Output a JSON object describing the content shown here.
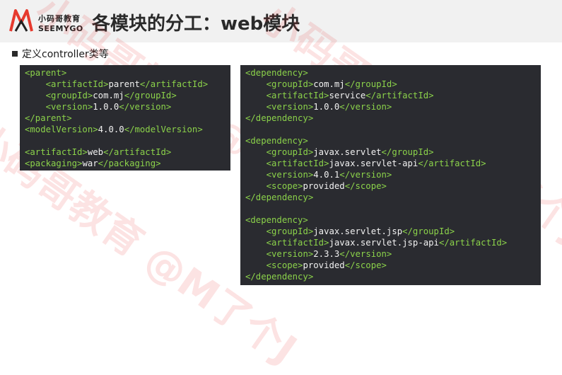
{
  "logo": {
    "cn": "小码哥教育",
    "en": "SEEMYGO"
  },
  "title": "各模块的分工：web模块",
  "subtitle": "定义controller类等",
  "watermark_text": "小码哥教育 @M了个J",
  "colors": {
    "code_bg": "#2a2b30",
    "code_text": "#f1f1f1",
    "tag": "#8bd24a",
    "logo_red": "#e63a2e"
  },
  "left_code": [
    {
      "i": 0,
      "parts": [
        [
          "t",
          "<parent>"
        ]
      ]
    },
    {
      "i": 1,
      "parts": [
        [
          "t",
          "<artifactId>"
        ],
        [
          "p",
          "parent"
        ],
        [
          "t",
          "</artifactId>"
        ]
      ]
    },
    {
      "i": 1,
      "parts": [
        [
          "t",
          "<groupId>"
        ],
        [
          "p",
          "com.mj"
        ],
        [
          "t",
          "</groupId>"
        ]
      ]
    },
    {
      "i": 1,
      "parts": [
        [
          "t",
          "<version>"
        ],
        [
          "p",
          "1.0.0"
        ],
        [
          "t",
          "</version>"
        ]
      ]
    },
    {
      "i": 0,
      "parts": [
        [
          "t",
          "</parent>"
        ]
      ]
    },
    {
      "i": 0,
      "parts": [
        [
          "t",
          "<modelVersion>"
        ],
        [
          "p",
          "4.0.0"
        ],
        [
          "t",
          "</modelVersion>"
        ]
      ]
    },
    {
      "i": 0,
      "parts": []
    },
    {
      "i": 0,
      "parts": [
        [
          "t",
          "<artifactId>"
        ],
        [
          "p",
          "web"
        ],
        [
          "t",
          "</artifactId>"
        ]
      ]
    },
    {
      "i": 0,
      "parts": [
        [
          "t",
          "<packaging>"
        ],
        [
          "p",
          "war"
        ],
        [
          "t",
          "</packaging>"
        ]
      ]
    }
  ],
  "right_code": [
    {
      "i": 0,
      "parts": [
        [
          "t",
          "<dependency>"
        ]
      ]
    },
    {
      "i": 1,
      "parts": [
        [
          "t",
          "<groupId>"
        ],
        [
          "p",
          "com.mj"
        ],
        [
          "t",
          "</groupId>"
        ]
      ]
    },
    {
      "i": 1,
      "parts": [
        [
          "t",
          "<artifactId>"
        ],
        [
          "p",
          "service"
        ],
        [
          "t",
          "</artifactId>"
        ]
      ]
    },
    {
      "i": 1,
      "parts": [
        [
          "t",
          "<version>"
        ],
        [
          "p",
          "1.0.0"
        ],
        [
          "t",
          "</version>"
        ]
      ]
    },
    {
      "i": 0,
      "parts": [
        [
          "t",
          "</dependency>"
        ]
      ]
    },
    {
      "i": 0,
      "parts": []
    },
    {
      "i": 0,
      "parts": [
        [
          "t",
          "<dependency>"
        ]
      ]
    },
    {
      "i": 1,
      "parts": [
        [
          "t",
          "<groupId>"
        ],
        [
          "p",
          "javax.servlet"
        ],
        [
          "t",
          "</groupId>"
        ]
      ]
    },
    {
      "i": 1,
      "parts": [
        [
          "t",
          "<artifactId>"
        ],
        [
          "p",
          "javax.servlet-api"
        ],
        [
          "t",
          "</artifactId>"
        ]
      ]
    },
    {
      "i": 1,
      "parts": [
        [
          "t",
          "<version>"
        ],
        [
          "p",
          "4.0.1"
        ],
        [
          "t",
          "</version>"
        ]
      ]
    },
    {
      "i": 1,
      "parts": [
        [
          "t",
          "<scope>"
        ],
        [
          "p",
          "provided"
        ],
        [
          "t",
          "</scope>"
        ]
      ]
    },
    {
      "i": 0,
      "parts": [
        [
          "t",
          "</dependency>"
        ]
      ]
    },
    {
      "i": 0,
      "parts": []
    },
    {
      "i": 0,
      "parts": [
        [
          "t",
          "<dependency>"
        ]
      ]
    },
    {
      "i": 1,
      "parts": [
        [
          "t",
          "<groupId>"
        ],
        [
          "p",
          "javax.servlet.jsp"
        ],
        [
          "t",
          "</groupId>"
        ]
      ]
    },
    {
      "i": 1,
      "parts": [
        [
          "t",
          "<artifactId>"
        ],
        [
          "p",
          "javax.servlet.jsp-api"
        ],
        [
          "t",
          "</artifactId>"
        ]
      ]
    },
    {
      "i": 1,
      "parts": [
        [
          "t",
          "<version>"
        ],
        [
          "p",
          "2.3.3"
        ],
        [
          "t",
          "</version>"
        ]
      ]
    },
    {
      "i": 1,
      "parts": [
        [
          "t",
          "<scope>"
        ],
        [
          "p",
          "provided"
        ],
        [
          "t",
          "</scope>"
        ]
      ]
    },
    {
      "i": 0,
      "parts": [
        [
          "t",
          "</dependency>"
        ]
      ]
    }
  ]
}
